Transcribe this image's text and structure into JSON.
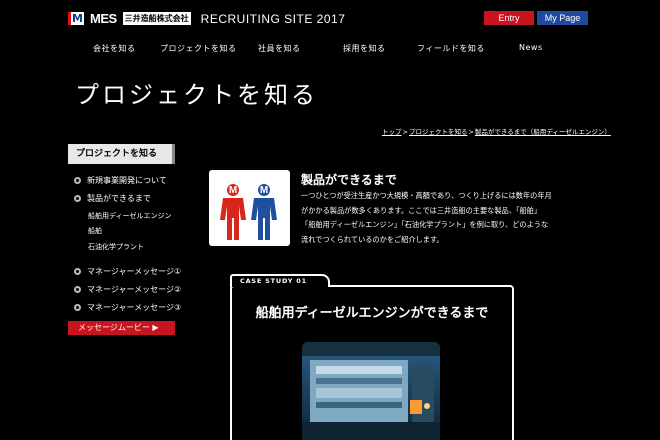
{
  "header": {
    "logo_mark": "M",
    "logo_mes": "MES",
    "logo_company": "三井造船株式会社",
    "site_title": "RECRUITING SITE 2017",
    "entry_label": "Entry",
    "mypage_label": "My Page"
  },
  "nav": {
    "items": [
      "会社を知る",
      "プロジェクトを知る",
      "社員を知る",
      "採用を知る",
      "フィールドを知る",
      "News"
    ]
  },
  "page_title": "プロジェクトを知る",
  "breadcrumb": {
    "items": [
      "トップ",
      "プロジェクトを知る",
      "製品ができるまで（船用ディーゼルエンジン）"
    ],
    "separator": ">"
  },
  "sidebar": {
    "heading": "プロジェクトを知る",
    "items": [
      "新規事業開発について",
      "製品ができるまで"
    ],
    "sub_items": [
      "船舶用ディーゼルエンジン",
      "船舶",
      "石油化学プラント"
    ],
    "messages": [
      "マネージャーメッセージ①",
      "マネージャーメッセージ②",
      "マネージャーメッセージ③"
    ],
    "movie_label": "メッセージムービー ▶"
  },
  "intro": {
    "icon_letters": [
      "M",
      "M"
    ],
    "title": "製品ができるまで",
    "lines": [
      "一つひとつが受注生産かつ大規模・高額であり、つくり上げるには数年の年月",
      "がかかる製品が数多くあります。ここでは三井造船の主要な製品、「船舶」",
      "「船舶用ディーゼルエンジン」「石油化学プラント」を例に取り、どのような",
      "流れでつくられているのかをご紹介します。"
    ]
  },
  "case_study": {
    "tab_label": "CASE STUDY 01",
    "title": "船舶用ディーゼルエンジンができるまで",
    "photo_icon": "factory-photo"
  },
  "colors": {
    "accent_red": "#c8141e",
    "accent_blue": "#1e4aa0",
    "background": "#000000",
    "text": "#ffffff"
  }
}
